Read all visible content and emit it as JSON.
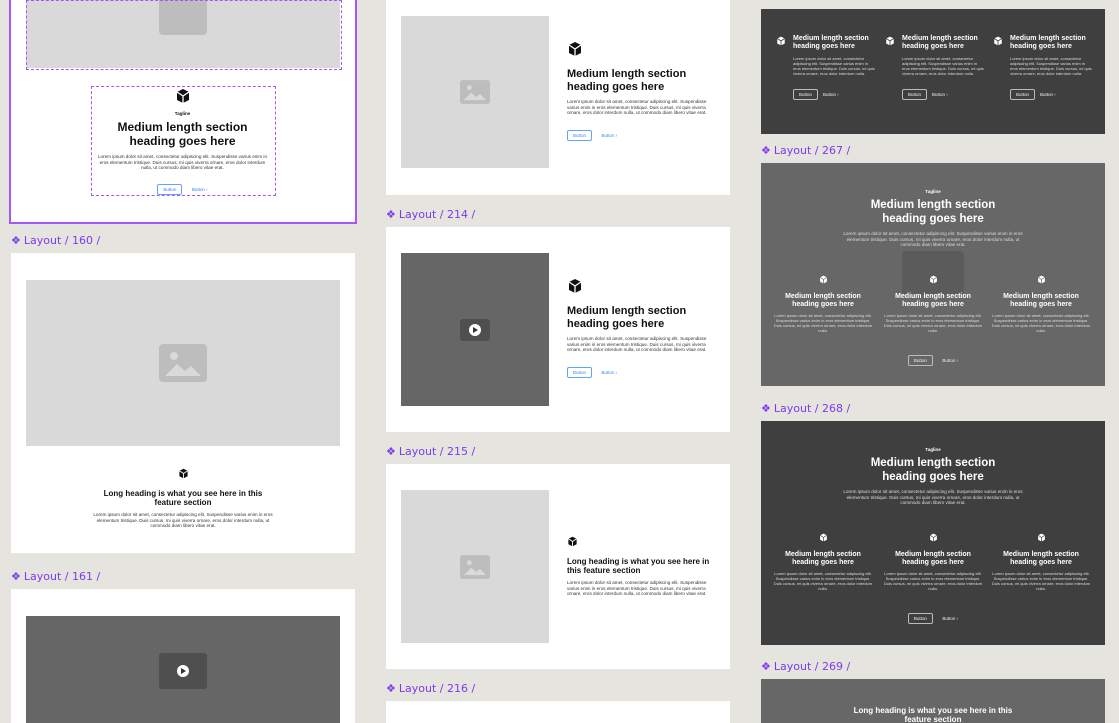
{
  "labels": {
    "l160": "Layout / 160 /",
    "l161": "Layout / 161 /",
    "l214": "Layout / 214 /",
    "l215": "Layout / 215 /",
    "l216": "Layout / 216 /",
    "l267": "Layout / 267 /",
    "l268": "Layout / 268 /",
    "l269": "Layout / 269 /"
  },
  "component_glyph": "❖",
  "accent_color": "#7c3aed",
  "selection_color": "#a855f7",
  "content": {
    "tagline": "Tagline",
    "heading_medium": "Medium length section heading goes here",
    "heading_long": "Long heading is what you see here in this feature section",
    "body_long": "Lorem ipsum dolor sit amet, consectetur adipiscing elit. Suspendisse varius enim in eros elementum tristique. Duis cursus, mi quis viverra ornare, eros dolor interdum nulla, ut commodo diam libero vitae erat.",
    "body_card": "Lorem ipsum dolor sit amet, consectetur adipiscing elit. Suspendisse varius enim in eros elementum tristique. Duis cursus, mi quis viverra ornare, eros dolor interdum nulla.",
    "button": "Button",
    "button_link": "Button",
    "chevron": "›"
  },
  "icons": {
    "placeholder": "image-placeholder-icon",
    "cube": "cube-icon",
    "play": "play-icon"
  }
}
